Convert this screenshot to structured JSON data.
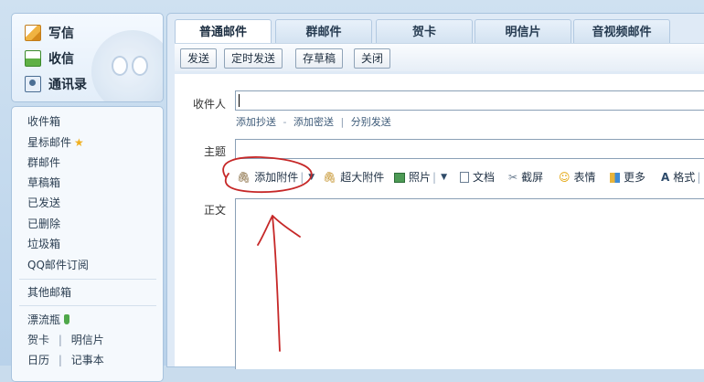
{
  "quick_actions": {
    "write": "写信",
    "inbox": "收信",
    "contacts": "通讯录"
  },
  "nav": {
    "folders": [
      "收件箱",
      "星标邮件",
      "群邮件",
      "草稿箱",
      "已发送",
      "已删除",
      "垃圾箱",
      "QQ邮件订阅"
    ],
    "other_mailbox": "其他邮箱",
    "drift_bottle": "漂流瓶",
    "card": "贺卡",
    "postcard": "明信片",
    "calendar": "日历",
    "notepad": "记事本",
    "pipe": "|"
  },
  "tabs": [
    "普通邮件",
    "群邮件",
    "贺卡",
    "明信片",
    "音视频邮件"
  ],
  "toolbar": {
    "send": "发送",
    "scheduled_send": "定时发送",
    "save_draft": "存草稿",
    "close": "关闭"
  },
  "compose": {
    "recipient_label": "收件人",
    "add_cc": "添加抄送",
    "dash": "-",
    "add_bcc": "添加密送",
    "pipe": "|",
    "separate_send": "分别发送",
    "subject_label": "主题",
    "body_label": "正文"
  },
  "attach_bar": {
    "add_attachment": "添加附件",
    "large_attachment": "超大附件",
    "photo": "照片",
    "document": "文档",
    "screenshot": "截屏",
    "emoji": "表情",
    "more": "更多",
    "format": "格式"
  },
  "colors": {
    "background": "#c9dced",
    "annotation": "#c62828",
    "link": "#3d5a78"
  }
}
